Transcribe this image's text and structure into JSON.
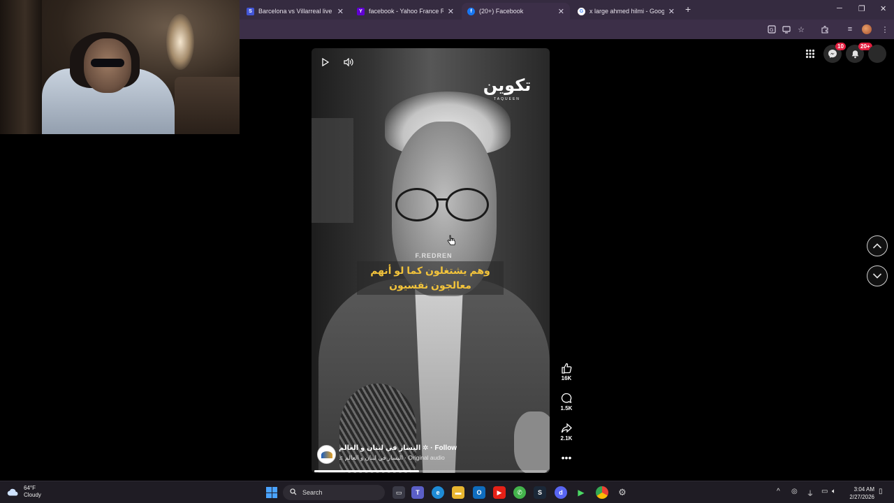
{
  "browser": {
    "tabs": [
      {
        "title": "Barcelona vs Villarreal live score",
        "favicon_color": "#4256d6",
        "favicon_glyph": "S",
        "active": false
      },
      {
        "title": "facebook - Yahoo France Résult",
        "favicon_color": "#6001d2",
        "favicon_glyph": "Y",
        "active": false
      },
      {
        "title": "(20+) Facebook",
        "favicon_color": "#1877f2",
        "favicon_glyph": "f",
        "active": true
      },
      {
        "title": "x large ahmed hilmi - Google S",
        "favicon_color": "#ffffff",
        "favicon_glyph": "G",
        "active": false
      }
    ],
    "toolbar_icons": [
      "translate-icon",
      "cast-icon",
      "bookmark-star-icon",
      "extensions-icon",
      "media-controls-icon",
      "profile-avatar",
      "menu-icon"
    ]
  },
  "facebook": {
    "messenger_badge": "10",
    "notifications_badge": "20+",
    "reel": {
      "logo_arabic": "تكوين",
      "logo_latin": "TAQUEEN",
      "name_strip": "F.REDREN",
      "subtitle_line1": "وهم يشتغلون كما لو أنهم",
      "subtitle_line2": "معالجون نفسيون",
      "page_name": "اليسار في لبنان و العالم",
      "follow_label": "Follow",
      "audio_source": "اليسار في لبنان و العالم",
      "audio_label": "Original audio",
      "progress": 0.45
    },
    "actions": {
      "likes": "16K",
      "comments": "1.5K",
      "shares": "2.1K"
    }
  },
  "taskbar": {
    "weather_temp": "64°F",
    "weather_desc": "Cloudy",
    "search_label": "Search",
    "time": "3:04 AM",
    "date": "2/27/2026"
  }
}
